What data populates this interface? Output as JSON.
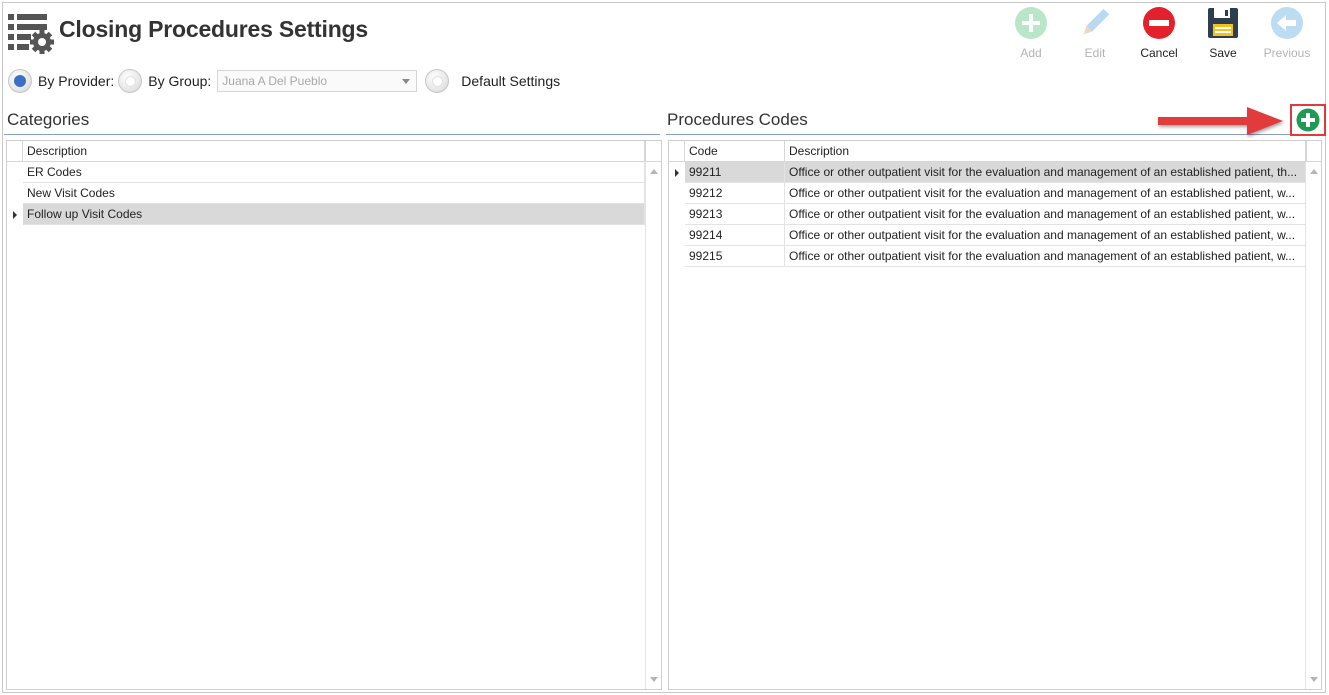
{
  "header": {
    "title": "Closing Procedures Settings"
  },
  "toolbar": {
    "add_label": "Add",
    "edit_label": "Edit",
    "cancel_label": "Cancel",
    "save_label": "Save",
    "previous_label": "Previous"
  },
  "filter": {
    "by_provider_label": "By Provider:",
    "by_group_label": "By Group:",
    "group_value": "Juana A Del Pueblo",
    "default_label": "Default Settings"
  },
  "categories": {
    "title": "Categories",
    "column": "Description",
    "rows": [
      {
        "description": "ER Codes"
      },
      {
        "description": "New Visit Codes"
      },
      {
        "description": "Follow up Visit Codes"
      }
    ]
  },
  "procedures": {
    "title": "Procedures Codes",
    "columns": [
      "Code",
      "Description"
    ],
    "rows": [
      {
        "code": "99211",
        "description": "Office or other outpatient visit for the evaluation and management of an established patient, th..."
      },
      {
        "code": "99212",
        "description": "Office or other outpatient visit for the evaluation and management of an established patient, w..."
      },
      {
        "code": "99213",
        "description": "Office or other outpatient visit for the evaluation and management of an established patient, w..."
      },
      {
        "code": "99214",
        "description": "Office or other outpatient visit for the evaluation and management of an established patient, w..."
      },
      {
        "code": "99215",
        "description": "Office or other outpatient visit for the evaluation and management of an established patient, w..."
      }
    ]
  },
  "colors": {
    "accent_blue": "#3a6fc4",
    "add_green": "#1f9a55",
    "cancel_red": "#e3212d",
    "annotation_red": "#e23a3a",
    "selected_row": "#d9d9d9"
  },
  "icons": [
    "settings-list-icon",
    "add-icon",
    "edit-pencil-icon",
    "cancel-icon",
    "save-floppy-icon",
    "previous-arrow-icon",
    "add-procedure-icon"
  ]
}
